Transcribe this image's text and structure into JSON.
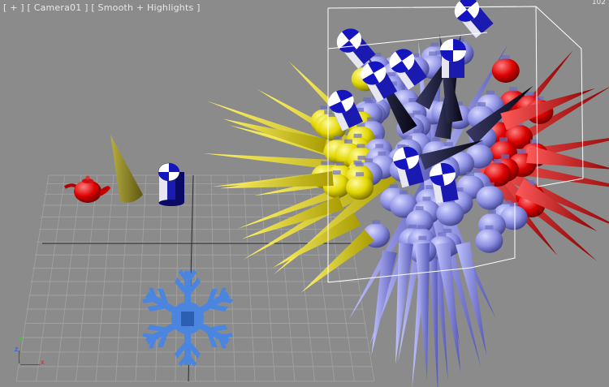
{
  "viewport": {
    "label_parts": [
      "[ + ]",
      "[ Camera01 ]",
      "[ Smooth + Highlights ]"
    ],
    "corner_label": "102",
    "axis": {
      "x": "x",
      "y": "y",
      "z": "z"
    }
  },
  "colors": {
    "background": "#8b8b8b",
    "grid": "#a3a3a3",
    "grid_axis": "#2a2a2a",
    "yellow": "#e8dc00",
    "red": "#e00000",
    "periwinkle": "#8f92e6",
    "navy": "#111133",
    "snowflake": "#4a86e0",
    "selection_box": "#ffffff"
  },
  "objects": [
    {
      "name": "teapot",
      "color": "red"
    },
    {
      "name": "cone",
      "color": "olive"
    },
    {
      "name": "cylinder",
      "color": "blue-white-checker"
    },
    {
      "name": "snowflake",
      "color": "blue"
    },
    {
      "name": "scattered-cluster",
      "color": "mixed"
    }
  ]
}
